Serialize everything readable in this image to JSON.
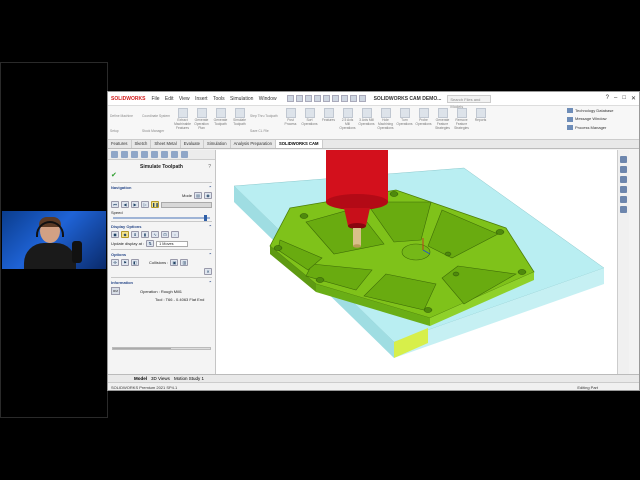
{
  "app": {
    "logo": "SOLIDWORKS",
    "document_title": "SOLIDWORKS CAM DEMO...",
    "search_placeholder": "Search Files and Models",
    "menu": [
      "File",
      "Edit",
      "View",
      "Insert",
      "Tools",
      "Simulation",
      "Window"
    ]
  },
  "ribbon": {
    "left_items": [
      "Define Machine",
      "Coordinate System",
      "Stock Manager",
      "Setup"
    ],
    "buttons": [
      "Extract Machinable Features",
      "Generate Operation Plan",
      "Generate Toolpath",
      "Simulate Toolpath",
      "Step Thru Toolpath",
      "Save CL File",
      "Post Process",
      "Sort Operations",
      "Features",
      "2.5 Axis Mill Operations",
      "3 Axis Mill Operations",
      "Hole Machining Operations",
      "Turn Operations",
      "Probe Operations",
      "Generate Feature Strategies",
      "Remove Feature Strategies",
      "Reports"
    ],
    "right_items": [
      "Technology Database",
      "Message Window",
      "Process Manager"
    ]
  },
  "tabs": [
    "Features",
    "Sketch",
    "Sheet Metal",
    "Evaluate",
    "Simulation",
    "Analysis Preparation",
    "SOLIDWORKS CAM"
  ],
  "active_tab": "SOLIDWORKS CAM",
  "property_manager": {
    "title": "Simulate Toolpath",
    "navigation": {
      "label": "Navigation",
      "mode_label": "Mode",
      "speed_label": "Speed"
    },
    "display_options": {
      "label": "Display Options",
      "update_label": "Update display at :",
      "update_value": "1 Moves"
    },
    "options": {
      "label": "Options",
      "collisions_label": "Collisions :"
    },
    "information": {
      "label": "Information",
      "operation": "Operation : Rough Mill1",
      "tool": "Tool : T66 - 0.4063 Flat End"
    }
  },
  "bottom_tabs": [
    "Model",
    "3D Views",
    "Motion Study 1"
  ],
  "active_bottom_tab": "Model",
  "status": {
    "left": "SOLIDWORKS Premium 2021 SP4.1",
    "right": "Editing Part"
  },
  "colors": {
    "part": "#7fc21a",
    "stock": "#a8e8ec",
    "spindle": "#d3101c"
  }
}
